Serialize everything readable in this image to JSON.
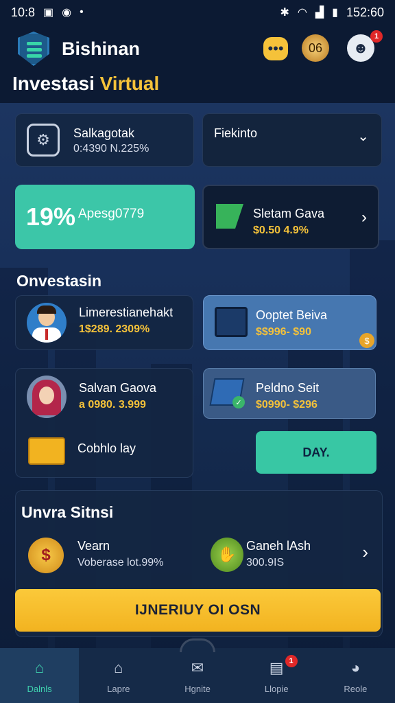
{
  "status_bar": {
    "time_left": "10:8",
    "time_right": "152:60"
  },
  "header": {
    "app_name": "Bishinan",
    "title_main": "Investasi",
    "title_accent": "Virtual",
    "coin_badge": "06",
    "bot_badge_count": "1"
  },
  "top_cards": {
    "summary": {
      "title": "Salkagotak",
      "subtitle": "0:4390 N.225%"
    },
    "dropdown": {
      "label": "Fiekinto"
    }
  },
  "balance_cards": {
    "highlight": {
      "percent": "19%",
      "label": "Apesg0779"
    },
    "secondary": {
      "title": "Sletam Gava",
      "value": "$0.50 4.9%"
    }
  },
  "investasi": {
    "section_title": "Onvestasin",
    "items": [
      {
        "title": "Limerestianehakt",
        "value": "1$289. 2309%"
      },
      {
        "title": "Ooptet Beiva",
        "value": "$$996- $90"
      },
      {
        "title": "Salvan Gaova",
        "value": "a 0980. 3.999"
      },
      {
        "title": "Peldno Seit",
        "value": "$0990- $296"
      }
    ],
    "bonus_label": "Cobhlo lay",
    "day_button": "DAY."
  },
  "simulasi": {
    "section_title": "Unvra Sitnsi",
    "item_left": {
      "title": "Vearn",
      "subtitle": "Voberase lot.99%"
    },
    "item_right": {
      "title": "Ganeh lAsh",
      "subtitle": "300.9IS"
    },
    "cta_label": "IJNERIUY OI OSN"
  },
  "bottom_nav": [
    {
      "label": "Dalnls"
    },
    {
      "label": "Lapre"
    },
    {
      "label": "Hgnite"
    },
    {
      "label": "Llopie",
      "badge": "1"
    },
    {
      "label": "Reole"
    }
  ],
  "colors": {
    "accent_yellow": "#f5c23a",
    "accent_teal": "#38c7a4",
    "background": "#0c1a33",
    "card": "#14263f"
  }
}
